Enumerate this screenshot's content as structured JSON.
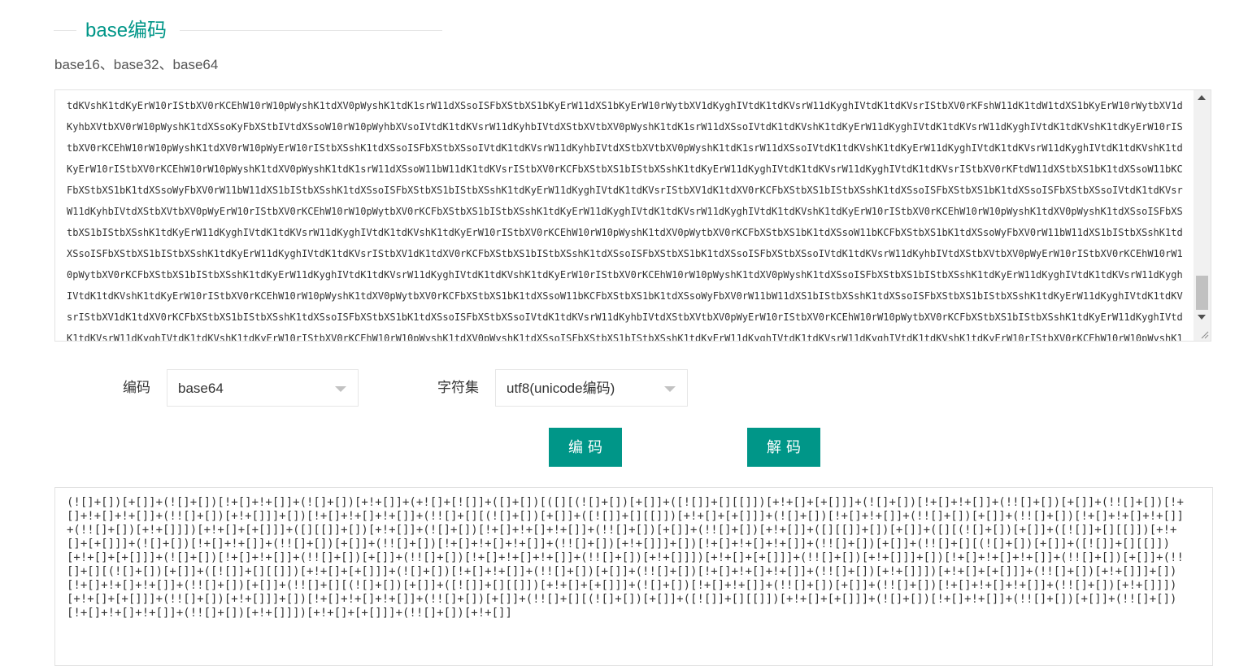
{
  "section": {
    "title": "base编码",
    "subtitle": "base16、base32、base64"
  },
  "input": {
    "value": "tdKVshK1tdKyErW10rIStbXV0rKCEhW10rW10pWyshK1tdXV0pWyshK1tdK1srW11dXSsoISFbXStbXS1bKyErW11dXS1bKyErW10rWytbXV1dKyghIVtdK1tdKVsrW11dKyghIVtdK1tdKVsrIStbXV0rKFshW11dK1tdW1tdXS1bKyErW10rWytbXV1dKyhbXVtbXV0rW10pWyshK1tdXSsoKyFbXStbIVtdXSsoW10rW10pWyhbXVsoIVtdK1tdKVsrW11dKyhbIVtdXStbXVtbXV0pWyshK1tdK1srW11dXSsoIVtdK1tdKVshK1tdKyErW11dKyghIVtdK1tdKVsrW11dKyghIVtdK1tdKVshK1tdKyErW10rIStbXV0rKCEhW10rW10pWyshK1tdXV0rW10pWyErW10rIStbXSshK1tdXSsoISFbXStbXSsoIVtdK1tdKVsrW11dKyhbIVtdXStbXVtbXV0pWyshK1tdK1srW11dXSsoIVtdK1tdKVshK1tdKyErW11dKyghIVtdK1tdKVsrW11dKyghIVtdK1tdKVshK1tdKyErW10rIStbXV0rKCEhW10rW10pWyshK1tdXV0pWyshK1tdK1srW11dXSsoW11bW11dK1tdKVsrIStbXV0rKCFbXStbXS1bIStbXSshK1tdKyErW11dKyghIVtdK1tdKVsrW11dKyghIVtdK1tdKVsrIStbXV0rKFtdW11dXStbXS1bK1tdXSsoW11bKCFbXStbXS1bK1tdXSsoWyFbXV0rW11bW11dXS1bIStbXSshK1tdXSsoISFbXStbXS1bIStbXSshK1tdKyErW11dKyghIVtdK1tdKVsrIStbXV1dK1tdXV0rKCFbXStbXS1bIStbXSshK1tdXSsoISFbXStbXS1bK1tdXSsoISFbXStbXSsoIVtdK1tdKVsrW11dKyhbIVtdXStbXVtbXV0pWyErW10rIStbXV0rKCEhW10rW10pWytbXV0rKCFbXStbXS1bIStbXSshK1tdKyErW11dKyghIVtdK1tdKVsrW11dKyghIVtdK1tdKVshK1tdKyErW10rIStbXV0rKCEhW10rW10pWyshK1tdXV0pWyshK1tdXSsoISFbXStbXS1bIStbXSshK1tdKyErW11dKyghIVtdK1tdKVsrW11dKyghIVtdK1tdKVshK1tdKyErW10rIStbXV0rKCEhW10rW10pWyshK1tdXV0pWytbXV0rKCFbXStbXS1bK1tdXSsoW11bKCFbXStbXS1bK1tdXSsoWyFbXV0rW11bW11dXS1bIStbXSshK1tdXSsoISFbXStbXS1bIStbXSshK1tdKyErW11dKyghIVtdK1tdKVsrIStbXV1dK1tdXV0rKCFbXStbXS1bIStbXSshK1tdXSsoISFbXStbXS1bK1tdXSsoISFbXStbXSsoIVtdK1tdKVsrW11dKyhbIVtdXStbXVtbXV0pWyErW10rIStbXV0rKCEhW10rW10pWytbXV0rKCFbXStbXS1bIStbXSshK1tdKyErW11dKyghIVtdK1tdKVsrW11dKyghIVtdK1tdKVshK1tdKyErW10rIStbXV0rKCEhW10rW10pWyshK1tdXV0pWyshK1tdXSsoISFbXStbXS1bIStbXSshK1tdKyErW11dKyghIVtdK1tdKVsrW11dKyghIVtdK1tdKVshK1tdKyErW10rIStbXV0rKCEhW10rW10pWyshK1tdXV0pWytbXV0rKCFbXStbXS1bK1tdXSsoW11bKCFbXStbXS1bK1tdXSsoWyFbXV0rW11bW11dXS1bIStbXSshK1tdXSsoISFbXStbXS1bIStbXSshK1tdKyErW11dKyghIVtdK1tdKVsrIStbXV1dK1tdXV0rKCFbXStbXS1bIStbXSshK1tdXSsoISFbXStbXS1bK1tdXSsoISFbXStbXSsoIVtdK1tdKVsrW11dKyhbIVtdXStbXVtbXV0pWyErW10rIStbXV0rKCEhW10rW10pWytbXV0rKCFbXStbXS1bIStbXSshK1tdKyErW11dKyghIVtdK1tdKVsrW11dKyghIVtdK1tdKVshK1tdKyErW10rIStbXV0rKCEhW10rW10pWyshK1tdXV0pWyshK1tdXSsoISFbXStbXS1bIStbXSshK1tdKyErW11dKyghIVtdK1tdKVsrW11dKyghIVtdK1tdKVshK1tdKyErW10rIStbXV0rKCEhW10rW10pWyshK1tdXV0pWytbXV0rKCFbXStbXS1bK1tdXSsoW11bKCFbXStbXS1bK1tdXSsoWyFbXV0rW11bW11dXS1bIStbXSshK1tdXSsoISFbXStbXS1bIStbXSshK1tdKyErW11dKyghIVtdK1tdKVsrIStbXV1dK1tdXV0rKCFbXStbXS1bIStbXSshK1tdXSsoISFbXStbXS1bK1tdXSsoISFbXStbXSsoIVtdK1tdKVsrW11dKyhbIVtdXStbXVtbXV0pWyErW10rIStbXV0rKCEhW10rW10pWytbXV0rKCFbXStbXS1bIStbXSshK1tdKyErW11dKyghIVtdK1tdKVsrW11dKyghIVtdK1tdKVshK1tdKyErW10rIStbXV0rKCEhW10rW10pWyshK1tdXV0pWyshK1tdXSsoISFbXStbXS1bIStbXSshK1tdKyErW11dKyghIVtdK1tdKVsrW11dKyghIVtdK1tdKVshK1tdKyErW10rIStbXV0rKCEhW10rW10pWyshK1tdXV0pWytbXV0rKCFbXStbXS1bK1tdXSsoW11bKCFbXStbXS1bK1tdXSsoWyFbXV0rW11bW11dXS1bIStbXSshK1tdXSsoISFbXStbXS1bIStbXSshK1tdKyErW11dKyghIVtdK1tdKVsrIStbXV1dK1tdXV0rKCFbXStbXS1bIStbXSshK1tdXSsoISFbXStbXS1bK1tdXSsoISFbXStbXSsoIVtdK1tdKVsrW11dKyhbIVtdXStbXVtbXV0pWyErW10rIStbXV0rKCEhW10rW10pWytbXV0rKCFbXStbXS1bIStbXSshK1tdKyErW11dKyghIVtdK1tdKVsrW11dKyghIVtdK1tdKVshK1tdKyErW10rIStbXV0rKCEhW10rW10pWyshK1tdXV0pWyshK1tdXSsoISFbXStbXS1bIStbXSshK1tdKyErW11dKyghIVtdK1tdKVsrW11dKyghIVtdK1tdKVshK1tdKyErW10rIStbXV0rKCEhW10rW10pWyshK1tdXV0pWytbXV0rKCFbXStbXS1bK1tdXSsoW11bKCFbXStbXS1bK1tdXSsoWyFbXV0rW11bW11dXS1bIStbXSshK1tdXSsoISFbXStbXS1bIStbXSshK1tdKyErW11dKyghIVtdK1tdKVsrIStbXV1dK1tdXV0rKCFbXStbXS1bIStbXSshK1tdXSsoISFbXStbXS1bK1tdXSsoISFbXStbXSsoIVtdK1tdKVsrW11dKyhbIVtdXStbXVtbXV0pWyErW10rIStbXV0rKCEhW10rW10pWytbXV0rKCFbXStbXS1bIStbXSshK1tdKyErW11dKyghIVtdK1tdKVsrW11dKyghIVtdK1tdKVshK1tdKyErW10rIStbXV0rKCEhW10rW10pWyshK1tdXV0pWyshK1tdXSsoISFbXStbXS1bIStbXSshK1tdKyErW11dKyghIVtdK1tdKVsrW11dKyghIVtdK1tdKVshK1tdKyErW10rIStbXV0rKCEhW10rW10pWyshK1tdXV0pWytbXV0rKCFbXStbXS1bK1tdXSsoW11bKCFbXStbXS1bK1tdXSsoWyFbXV0rW11bW11dXS1bIStbXSshK1tdXSsoISFbXStbXS1bIStbXSshK1tdKyErW11dKyghIVtdK1tdKVsrIStbXV1dK1tdXV0rKCFbXStbXS1bIStbXSshK1tdXSsoISFbXStbXS1bK1tdXSsoISFbXStbXSsoIVtdK1tdKVsrW11dKyhbIVtdXStbXVtbXV0pWyErW10rIStbXV0rKCEhW10rW10pWytbXV0rKCFbXStbXS1bIStbXSshK1tdKyErW11dKyghIVtdK1tdKVsrW11dKyghIVtdK1tdKVshK1tdKyErW10rIStbXV0rKCEhW10rW10pWyshK1tdXV0p"
  },
  "controls": {
    "encoding_label": "编码",
    "encoding_value": "base64",
    "charset_label": "字符集",
    "charset_value": "utf8(unicode编码)",
    "encode_button": "编码",
    "decode_button": "解码"
  },
  "output": {
    "value": "(![]+[])[+[]]+(![]+[])[!+[]+!+[]]+(![]+[])[+!+[]]+(+![]+[![]]+([]+[])[([][(![]+[])[+[]]+([![]]+[][[]])[+!+[]+[+[]]]+(![]+[])[!+[]+!+[]]+(!![]+[])[+[]]+(!![]+[])[!+[]+!+[]+!+[]]+(!![]+[])[+!+[]]]+[])[!+[]+!+[]+!+[]]+(!![]+[][(![]+[])[+[]]+([![]]+[][[]])[+!+[]+[+[]]]+(![]+[])[!+[]+!+[]]+(!![]+[])[+[]]+(!![]+[])[!+[]+!+[]+!+[]]+(!![]+[])[+!+[]]])[+!+[]+[+[]]]+([][[]]+[])[+!+[]]+(![]+[])[!+[]+!+[]+!+[]]+(!![]+[])[+[]]+(!![]+[])[+!+[]]+([][[]]+[])[+[]]+([][(![]+[])[+[]]+([![]]+[][[]])[+!+[]+[+[]]]+(![]+[])[!+[]+!+[]]+(!![]+[])[+[]]+(!![]+[])[!+[]+!+[]+!+[]]+(!![]+[])[+!+[]]]+[])[!+[]+!+[]+!+[]]+(!![]+[])[+[]]+(!![]+[][(![]+[])[+[]]+([![]]+[][[]])[+!+[]+[+[]]]+(![]+[])[!+[]+!+[]]+(!![]+[])[+[]]+(!![]+[])[!+[]+!+[]+!+[]]+(!![]+[])[+!+[]]])[+!+[]+[+[]]]+(!![]+[])[+!+[]]]+[])[!+[]+!+[]+!+[]]+(!![]+[])[+[]]+(!![]+[][(![]+[])[+[]]+([![]]+[][[]])[+!+[]+[+[]]]+(![]+[])[!+[]+!+[]]+(!![]+[])[+[]]+(!![]+[])[!+[]+!+[]+!+[]]+(!![]+[])[+!+[]]])[+!+[]+[+[]]]+(!![]+[])[+!+[]]]+[])[!+[]+!+[]+!+[]]+(!![]+[])[+[]]+(!![]+[][(![]+[])[+[]]+([![]]+[][[]])[+!+[]+[+[]]]+(![]+[])[!+[]+!+[]]+(!![]+[])[+[]]+(!![]+[])[!+[]+!+[]+!+[]]+(!![]+[])[+!+[]]])[+!+[]+[+[]]]+(!![]+[])[+!+[]]]+[])[!+[]+!+[]+!+[]]+(!![]+[])[+[]]+(!![]+[][(![]+[])[+[]]+([![]]+[][[]])[+!+[]+[+[]]]+(![]+[])[!+[]+!+[]]+(!![]+[])[+[]]+(!![]+[])[!+[]+!+[]+!+[]]+(!![]+[])[+!+[]]])[+!+[]+[+[]]]+(!![]+[])[+!+[]]"
  },
  "colors": {
    "accent": "#009688"
  },
  "icons": {
    "dropdown": "chevron-down-icon",
    "scroll_up": "arrow-up-icon",
    "scroll_down": "arrow-down-icon",
    "resize": "resize-handle-icon"
  }
}
